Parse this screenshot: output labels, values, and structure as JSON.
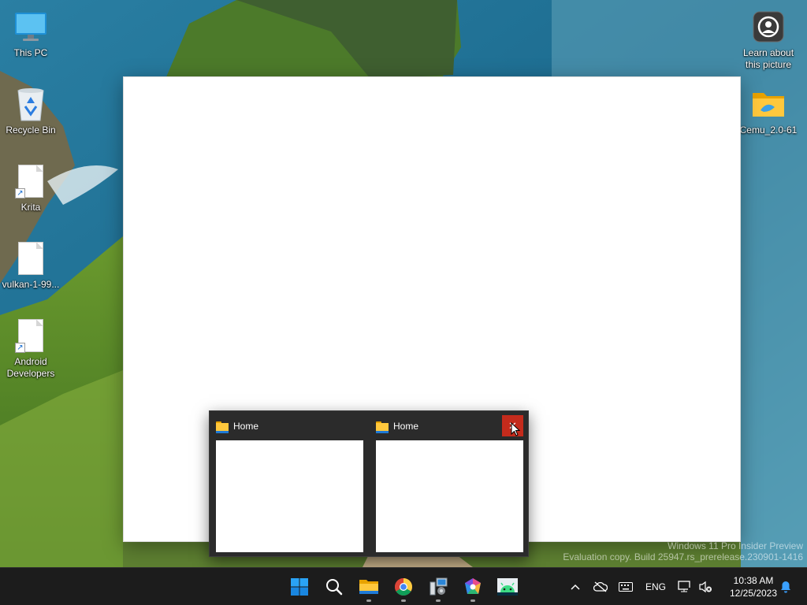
{
  "desktop": {
    "icons": [
      {
        "label": "This PC",
        "icon": "this-pc-icon"
      },
      {
        "label": "Recycle Bin",
        "icon": "recycle-bin-icon"
      },
      {
        "label": "Krita",
        "icon": "shortcut-file-icon"
      },
      {
        "label": "vulkan-1-99...",
        "icon": "file-icon"
      },
      {
        "label": "Android Developers",
        "icon": "shortcut-file-icon"
      },
      {
        "label": "Learn about this picture",
        "icon": "camera-icon"
      },
      {
        "label": "Cemu_2.0-61",
        "icon": "folder-icon"
      }
    ]
  },
  "preview": {
    "thumbnails": [
      {
        "title": "Home",
        "icon": "folder-icon"
      },
      {
        "title": "Home",
        "icon": "folder-icon",
        "close_hover": true
      }
    ],
    "close_glyph": "✕",
    "close_color": "#c42b1c"
  },
  "watermark": {
    "line1": "Windows 11 Pro Insider Preview",
    "line2": "Evaluation copy. Build 25947.rs_prerelease.230901-1416"
  },
  "taskbar": {
    "apps": [
      {
        "name": "start-button",
        "icon": "windows-logo-icon"
      },
      {
        "name": "search-button",
        "icon": "search-icon"
      },
      {
        "name": "file-explorer",
        "icon": "folder-icon",
        "running": true
      },
      {
        "name": "chrome",
        "icon": "chrome-icon",
        "running": true
      },
      {
        "name": "system-app",
        "icon": "computer-settings-icon",
        "running": true
      },
      {
        "name": "hexagon-app",
        "icon": "hexagon-app-icon",
        "running": true
      },
      {
        "name": "android-studio",
        "icon": "android-icon",
        "running": false
      }
    ],
    "tray": {
      "chevron": "^",
      "language": "ENG",
      "time": "10:38 AM",
      "date": "12/25/2023"
    },
    "accent": "#0078d4"
  }
}
